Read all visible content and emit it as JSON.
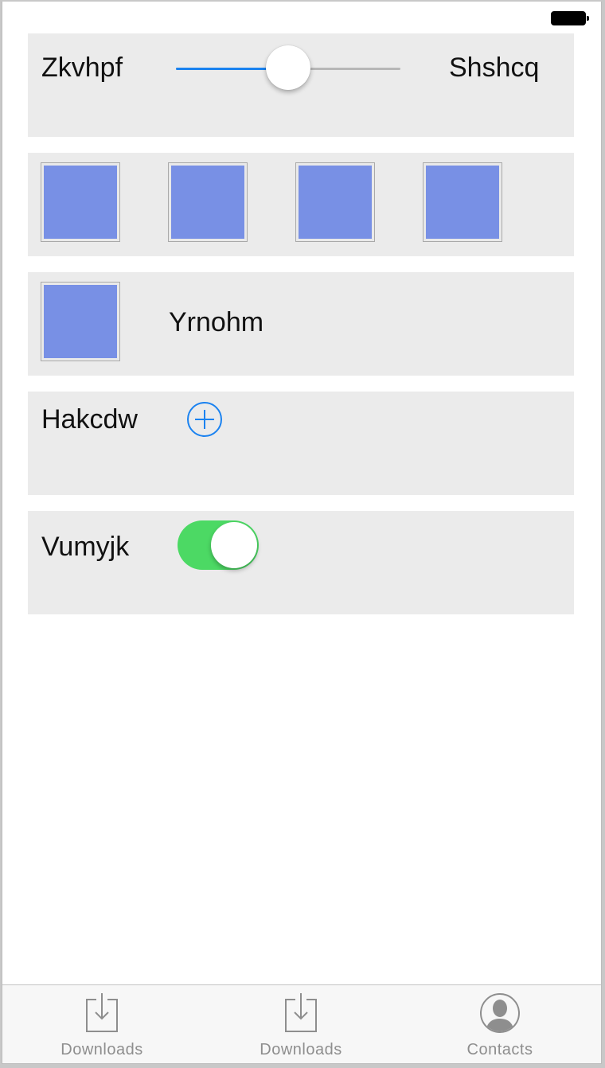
{
  "status_bar": {
    "battery_icon": "battery-full-icon"
  },
  "slider_row": {
    "min_label": "Zkvhpf",
    "max_label": "Shshcq",
    "value": 0.5,
    "accent_color": "#1a82f0"
  },
  "tiles_row": {
    "tile_count": 4,
    "tile_color": "#7890e5"
  },
  "image_label_row": {
    "label": "Yrnohm"
  },
  "add_row": {
    "label": "Hakcdw",
    "icon": "add-circle-icon"
  },
  "toggle_row": {
    "label": "Vumyjk",
    "on": true,
    "on_color": "#4cd964"
  },
  "tab_bar": {
    "tabs": [
      {
        "label": "Downloads",
        "icon": "downloads-icon"
      },
      {
        "label": "Downloads",
        "icon": "downloads-icon"
      },
      {
        "label": "Contacts",
        "icon": "contacts-icon"
      }
    ]
  }
}
